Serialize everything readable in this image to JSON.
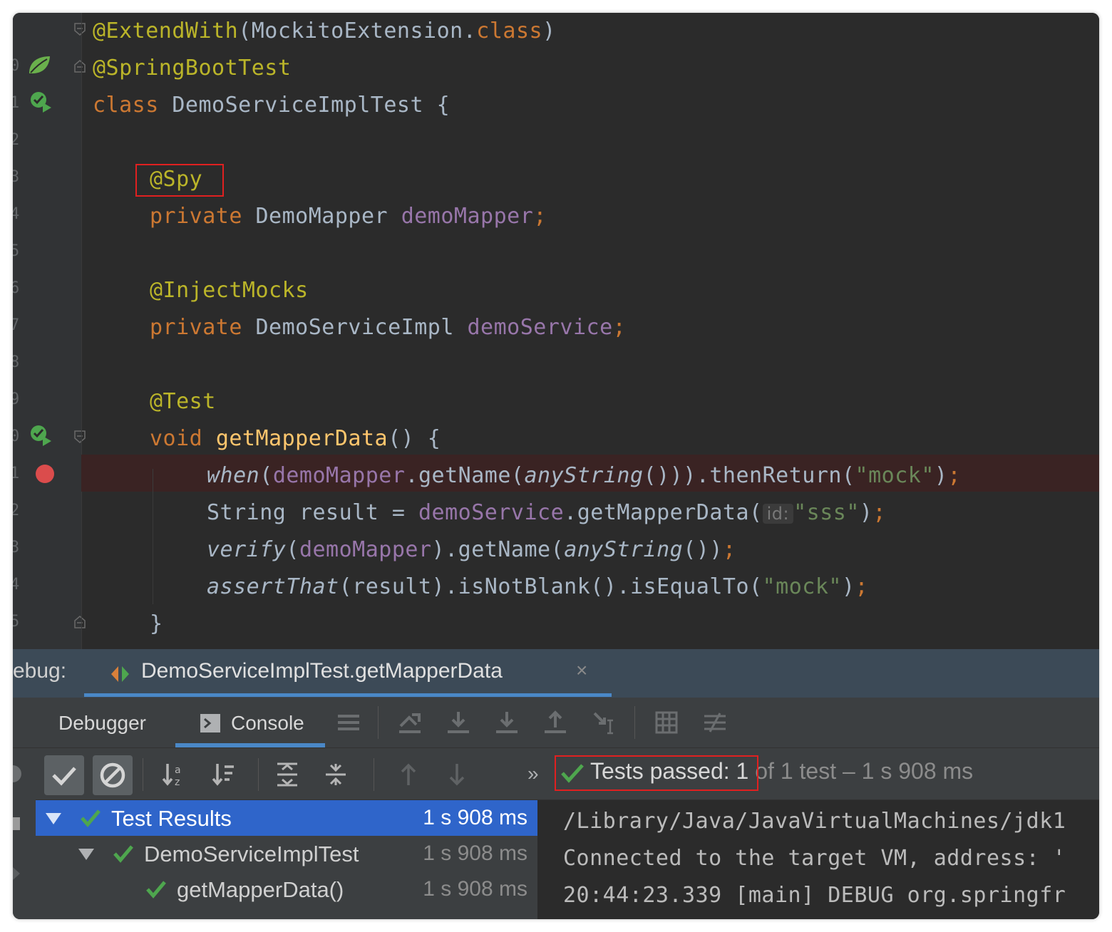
{
  "editor": {
    "gutter_line_numbers": [
      "0",
      "1",
      "2",
      "3",
      "4",
      "5",
      "6",
      "7",
      "8",
      "9",
      "0",
      "1",
      "2",
      "3",
      "4",
      "5"
    ],
    "code": {
      "l1_ann": "@ExtendWith",
      "l1_a": "(MockitoExtension.",
      "l1_kw": "class",
      "l1_b": ")",
      "l2_ann": "@SpringBootTest",
      "l3_kw": "class",
      "l3_rest": " DemoServiceImplTest {",
      "l5_ann": "@Spy",
      "l6_kw": "private",
      "l6_type": " DemoMapper ",
      "l6_fld": "demoMapper",
      "l6_semi": ";",
      "l8_ann": "@InjectMocks",
      "l9_kw": "private",
      "l9_type": " DemoServiceImpl ",
      "l9_fld": "demoService",
      "l9_semi": ";",
      "l11_ann": "@Test",
      "l12_kw": "void",
      "l12_sp": " ",
      "l12_fn": "getMapperData",
      "l12_rest": "() {",
      "l13_when": "when",
      "l13_p1": "(",
      "l13_fld": "demoMapper",
      "l13_p2": ".getName(",
      "l13_any": "anyString",
      "l13_p3": "())).thenReturn(",
      "l13_str": "\"mock\"",
      "l13_p4": ")",
      "l13_semi": ";",
      "l14_a": "String result = ",
      "l14_fld": "demoService",
      "l14_b": ".getMapperData(",
      "l14_hint": "id:",
      "l14_str": "\"sss\"",
      "l14_c": ")",
      "l14_semi": ";",
      "l15_verify": "verify",
      "l15_p1": "(",
      "l15_fld": "demoMapper",
      "l15_p2": ").getName(",
      "l15_any": "anyString",
      "l15_p3": "())",
      "l15_semi": ";",
      "l16_assert": "assertThat",
      "l16_p1": "(result).isNotBlank().isEqualTo(",
      "l16_str": "\"mock\"",
      "l16_p2": ")",
      "l16_semi": ";",
      "l17": "}"
    }
  },
  "debug_tab_bar": {
    "label": "ebug:",
    "tab_title": "DemoServiceImplTest.getMapperData",
    "close": "×"
  },
  "debugger_toolbar": {
    "debugger_tab": "Debugger",
    "console_tab": "Console"
  },
  "test_toolbar": {
    "passed_label": "Tests passed: ",
    "passed_count": "1",
    "passed_rest": " of 1 test – 1 s 908 ms",
    "more": "»"
  },
  "results_tree": {
    "rows": [
      {
        "label": "Test Results",
        "time": "1 s 908 ms"
      },
      {
        "label": "DemoServiceImplTest",
        "time": "1 s 908 ms"
      },
      {
        "label": "getMapperData()",
        "time": "1 s 908 ms"
      }
    ]
  },
  "console": {
    "lines": [
      "/Library/Java/JavaVirtualMachines/jdk1",
      "Connected to the target VM, address: '",
      "20:44:23.339 [main] DEBUG org.springfr"
    ]
  },
  "colors": {
    "keyword": "#cc7832",
    "annotation": "#bbb529",
    "field": "#9876aa",
    "string": "#6a8759",
    "method": "#ffc66d",
    "selection": "#2f65ca",
    "pass_green": "#4ea64e",
    "highlight_box": "#e02020"
  }
}
